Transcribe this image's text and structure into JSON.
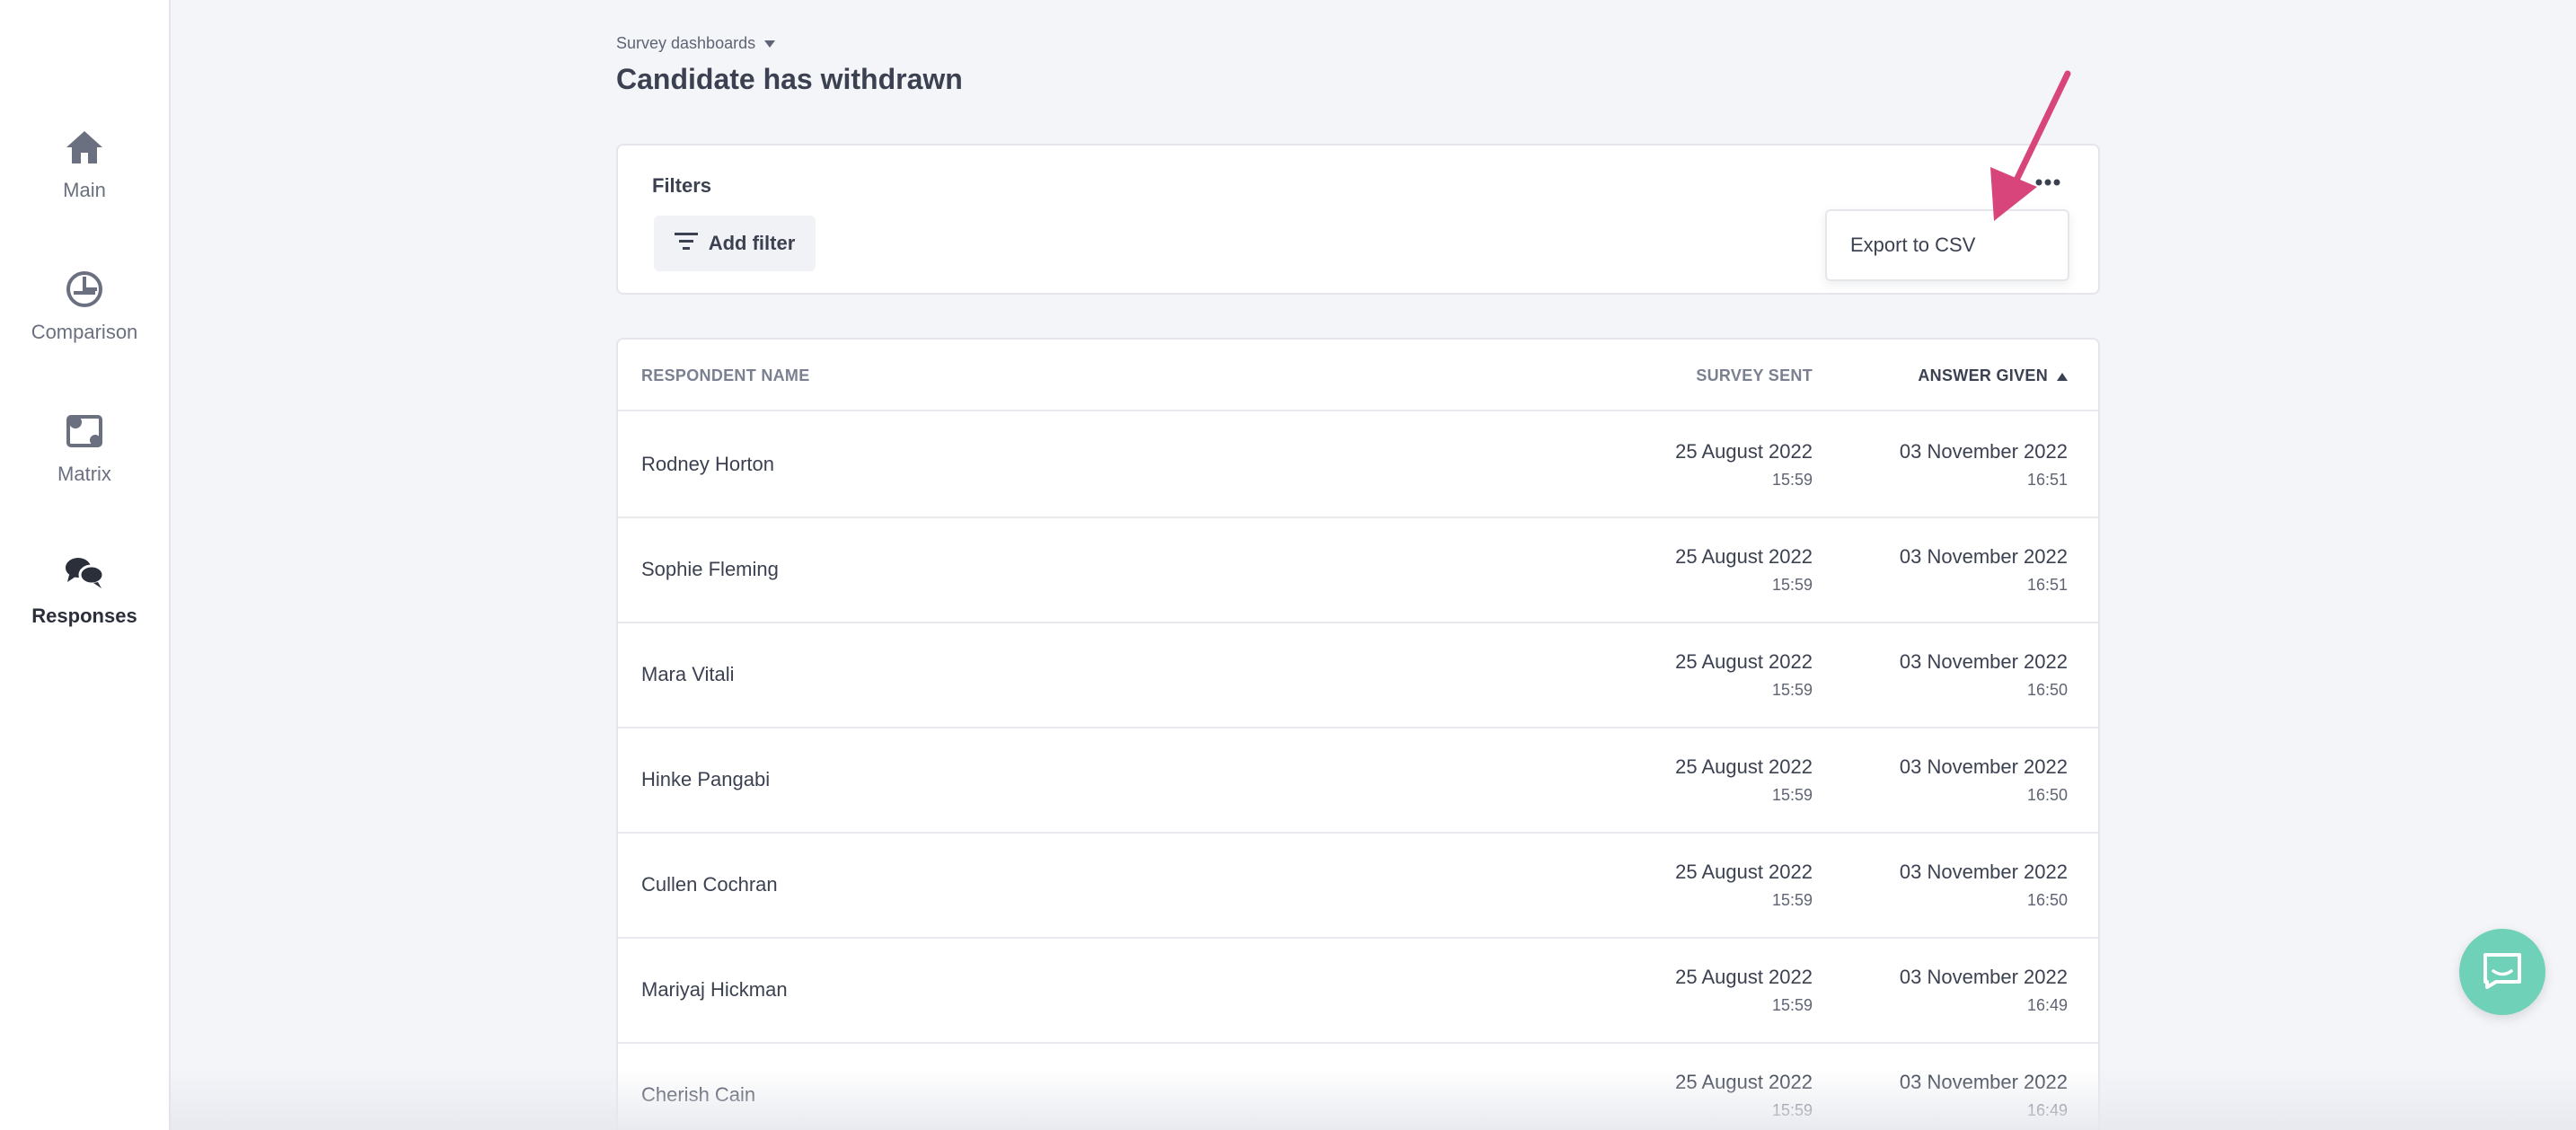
{
  "sidebar": {
    "items": [
      {
        "label": "Main",
        "icon": "home-icon",
        "active": false
      },
      {
        "label": "Comparison",
        "icon": "comparison-icon",
        "active": false
      },
      {
        "label": "Matrix",
        "icon": "matrix-icon",
        "active": false
      },
      {
        "label": "Responses",
        "icon": "chat-bubbles-icon",
        "active": true
      }
    ]
  },
  "header": {
    "breadcrumb": "Survey dashboards",
    "title": "Candidate has withdrawn"
  },
  "filters": {
    "label": "Filters",
    "add_filter_label": "Add filter",
    "menu": {
      "export_label": "Export to CSV"
    }
  },
  "table": {
    "columns": {
      "name": "RESPONDENT NAME",
      "sent": "SURVEY SENT",
      "answer": "ANSWER GIVEN"
    },
    "rows": [
      {
        "name": "Rodney Horton",
        "sent_date": "25 August 2022",
        "sent_time": "15:59",
        "answer_date": "03 November 2022",
        "answer_time": "16:51"
      },
      {
        "name": "Sophie Fleming",
        "sent_date": "25 August 2022",
        "sent_time": "15:59",
        "answer_date": "03 November 2022",
        "answer_time": "16:51"
      },
      {
        "name": "Mara Vitali",
        "sent_date": "25 August 2022",
        "sent_time": "15:59",
        "answer_date": "03 November 2022",
        "answer_time": "16:50"
      },
      {
        "name": "Hinke Pangabi",
        "sent_date": "25 August 2022",
        "sent_time": "15:59",
        "answer_date": "03 November 2022",
        "answer_time": "16:50"
      },
      {
        "name": "Cullen Cochran",
        "sent_date": "25 August 2022",
        "sent_time": "15:59",
        "answer_date": "03 November 2022",
        "answer_time": "16:50"
      },
      {
        "name": "Mariyaj Hickman",
        "sent_date": "25 August 2022",
        "sent_time": "15:59",
        "answer_date": "03 November 2022",
        "answer_time": "16:49"
      },
      {
        "name": "Cherish Cain",
        "sent_date": "25 August 2022",
        "sent_time": "15:59",
        "answer_date": "03 November 2022",
        "answer_time": "16:49"
      }
    ]
  },
  "colors": {
    "accent_arrow": "#d8457a",
    "chat_launcher": "#6fd1b7",
    "sidebar_icon": "#6b7080",
    "sidebar_icon_active": "#2a2f3a"
  }
}
